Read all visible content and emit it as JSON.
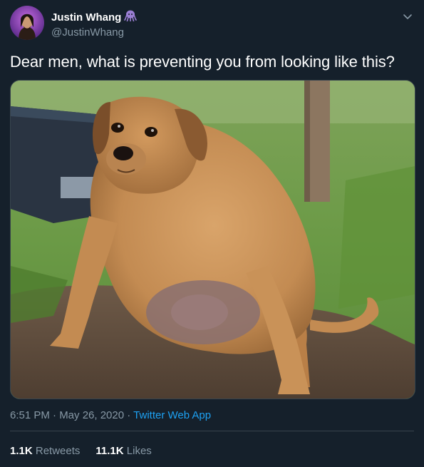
{
  "tweet": {
    "author": {
      "display_name": "Justin Whang",
      "handle": "@JustinWhang",
      "badge_icon": "octopus-icon",
      "badge_color": "#9b7fd4"
    },
    "menu_icon": "chevron-down-icon",
    "text": "Dear men, what is preventing you from looking like this?",
    "media": {
      "icon": "photo-overweight-dog"
    },
    "timestamp": "6:51 PM · May 26, 2020",
    "separator": " · ",
    "source_app": "Twitter Web App",
    "stats": {
      "retweets_count": "1.1K",
      "retweets_label": "Retweets",
      "likes_count": "11.1K",
      "likes_label": "Likes"
    }
  },
  "colors": {
    "background": "#15202b",
    "text_primary": "#ffffff",
    "text_secondary": "#8899a6",
    "link": "#1da1f2",
    "divider": "#38444d"
  }
}
